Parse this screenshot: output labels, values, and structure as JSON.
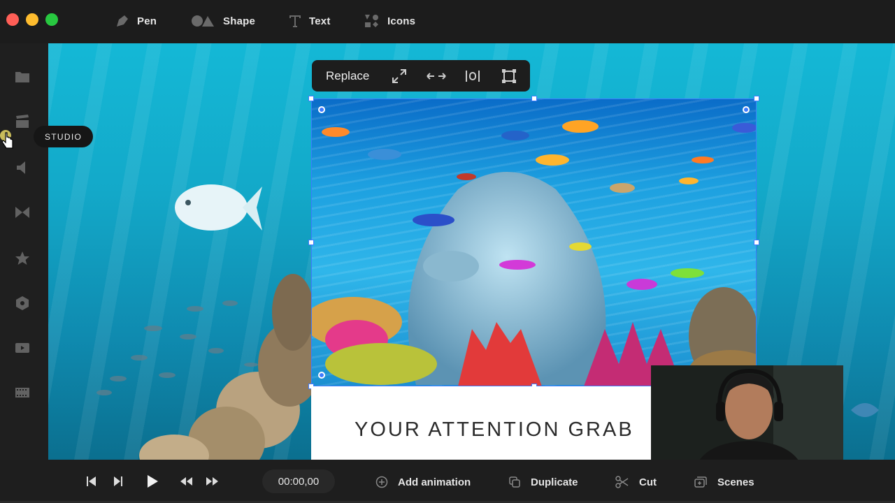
{
  "window": {
    "traffic_lights": {
      "close": "#ff5f57",
      "minimize": "#febc2e",
      "maximize": "#28c840"
    }
  },
  "toolbar": {
    "tools": [
      {
        "label": "Pen",
        "icon": "pen-icon"
      },
      {
        "label": "Shape",
        "icon": "shape-icon"
      },
      {
        "label": "Text",
        "icon": "text-icon"
      },
      {
        "label": "Icons",
        "icon": "icons-icon"
      }
    ]
  },
  "sidebar": {
    "items": [
      {
        "icon": "folder-icon"
      },
      {
        "icon": "studio-clapper-icon"
      },
      {
        "icon": "audio-icon"
      },
      {
        "icon": "transition-icon"
      },
      {
        "icon": "star-icon"
      },
      {
        "icon": "shape-hexagon-icon"
      },
      {
        "icon": "video-icon"
      },
      {
        "icon": "film-strip-icon"
      }
    ],
    "tooltip": "STUDIO"
  },
  "image_toolbar": {
    "replace_label": "Replace",
    "icons": [
      "expand-icon",
      "swap-icon",
      "align-center-icon",
      "crop-icon"
    ]
  },
  "canvas": {
    "headline": "YOUR ATTENTION GRAB"
  },
  "playback": {
    "timecode": "00:00,00",
    "actions": [
      {
        "label": "Add animation",
        "icon": "add-circle-icon"
      },
      {
        "label": "Duplicate",
        "icon": "duplicate-icon"
      },
      {
        "label": "Cut",
        "icon": "scissors-icon"
      },
      {
        "label": "Scenes",
        "icon": "scenes-icon"
      }
    ]
  },
  "colors": {
    "selection": "#3d7bff",
    "bar": "#1e1e1e",
    "ocean": "#14b8d6"
  }
}
